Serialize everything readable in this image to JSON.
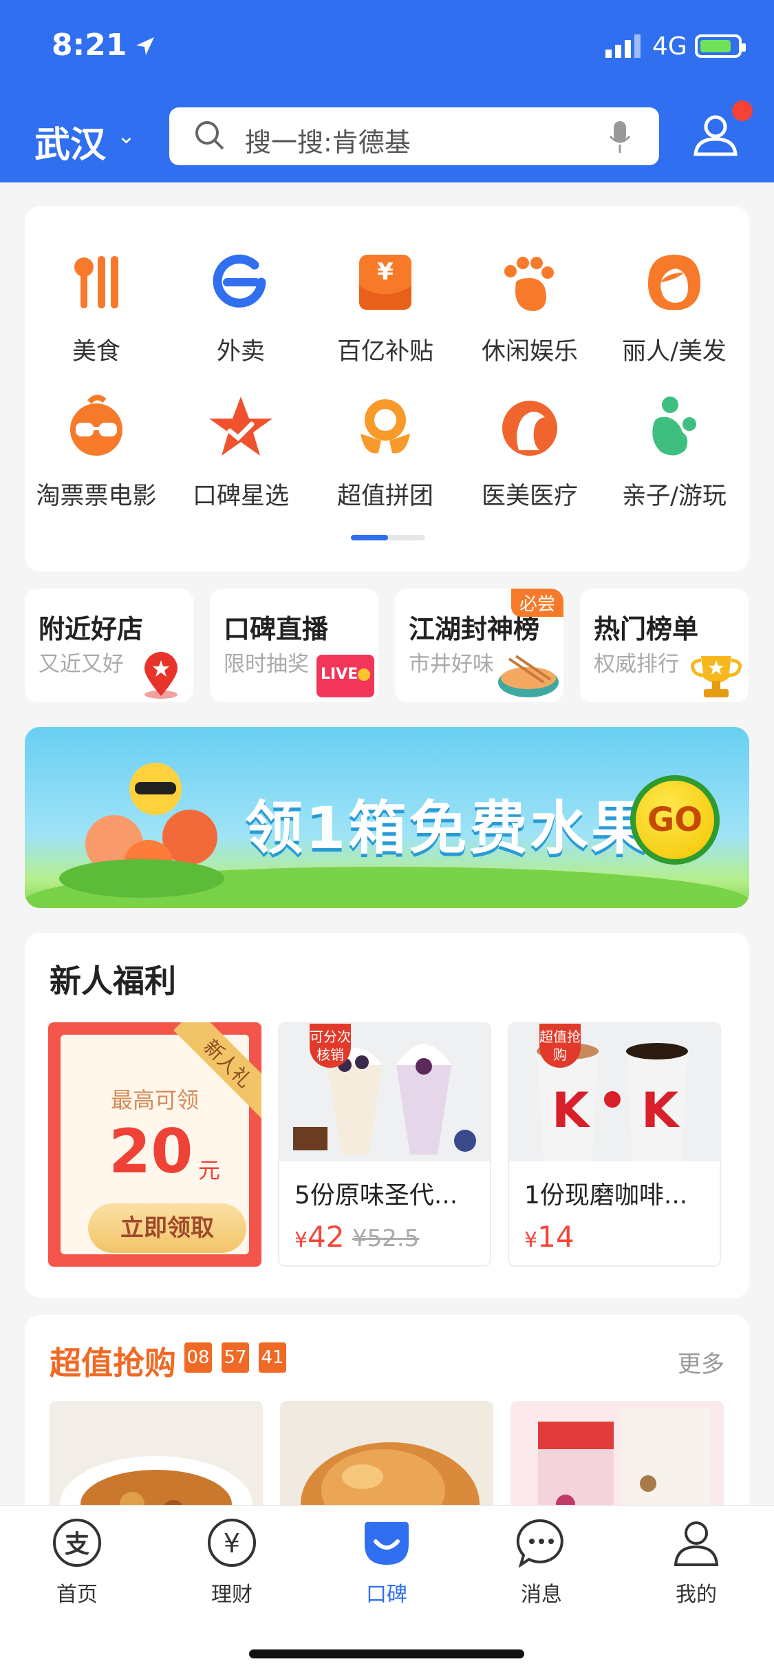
{
  "status_bar": {
    "time": "8:21",
    "network": "4G"
  },
  "header": {
    "city": "武汉",
    "search_placeholder": "搜一搜:肯德基"
  },
  "categories": [
    {
      "label": "美食",
      "icon": "utensils-icon"
    },
    {
      "label": "外卖",
      "icon": "delivery-e-icon"
    },
    {
      "label": "百亿补贴",
      "icon": "yuan-subsidy-icon"
    },
    {
      "label": "休闲娱乐",
      "icon": "paw-icon"
    },
    {
      "label": "丽人/美发",
      "icon": "beauty-icon"
    },
    {
      "label": "淘票票电影",
      "icon": "movie-glasses-icon"
    },
    {
      "label": "口碑星选",
      "icon": "star-icon"
    },
    {
      "label": "超值拼团",
      "icon": "group-buy-icon"
    },
    {
      "label": "医美医疗",
      "icon": "medical-beauty-icon"
    },
    {
      "label": "亲子/游玩",
      "icon": "family-icon"
    }
  ],
  "features": [
    {
      "title": "附近好店",
      "subtitle": "又近又好",
      "icon": "location-pin-icon"
    },
    {
      "title": "口碑直播",
      "subtitle": "限时抽奖",
      "icon": "live-tv-icon",
      "icon_text": "LIVE"
    },
    {
      "title": "江湖封神榜",
      "subtitle": "市井好味",
      "badge": "必尝",
      "icon": "food-bowl-icon"
    },
    {
      "title": "热门榜单",
      "subtitle": "权威排行",
      "icon": "trophy-icon"
    }
  ],
  "banner": {
    "text": "领1箱免费水果",
    "go": "GO"
  },
  "newbie": {
    "title": "新人福利",
    "coupon": {
      "label": "最高可领",
      "amount": "20",
      "unit": "元",
      "button": "立即领取",
      "ribbon": "新人礼"
    },
    "products": [
      {
        "name": "5份原味圣代...",
        "price": "42",
        "currency": "¥",
        "old_price": "¥52.5",
        "tag": "可分次核销"
      },
      {
        "name": "1份现磨咖啡...",
        "price": "14",
        "currency": "¥",
        "tag": "超值抢购"
      }
    ]
  },
  "flash_sale": {
    "title": "超值抢购",
    "timer": [
      "08",
      "57",
      "41"
    ],
    "more": "更多"
  },
  "tabbar": [
    {
      "label": "首页",
      "icon": "alipay-icon"
    },
    {
      "label": "理财",
      "icon": "yuan-coin-icon"
    },
    {
      "label": "口碑",
      "icon": "koubei-icon",
      "active": true
    },
    {
      "label": "消息",
      "icon": "chat-bubble-icon"
    },
    {
      "label": "我的",
      "icon": "person-icon"
    }
  ],
  "colors": {
    "brand_blue": "#2f6ff0",
    "accent_orange": "#f77a2a",
    "price_red": "#f4473a"
  }
}
